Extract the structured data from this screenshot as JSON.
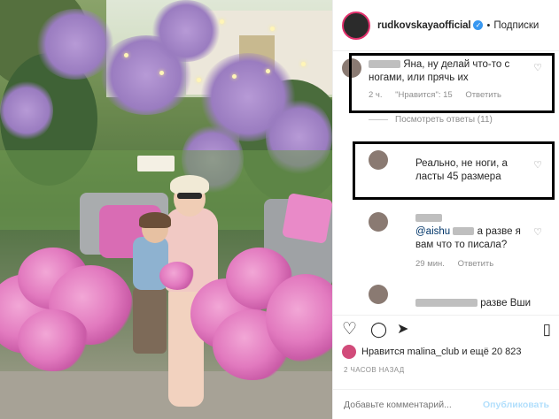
{
  "post": {
    "username": "rudkovskayaofficial",
    "separator": "•",
    "follow_label": "Подписки"
  },
  "comments": [
    {
      "text": "Яна, ну делай что-то с ногами, или прячь их",
      "meta_time": "2 ч.",
      "meta_likes": "\"Нравится\": 15",
      "meta_reply": "Ответить"
    },
    {
      "text": "Реально, не ноги, а ласты 45 размера"
    },
    {
      "mention": "@aishu",
      "text": "а разве я вам что то писала?",
      "meta_time": "29 мин.",
      "meta_reply": "Ответить"
    },
    {
      "text": "разве Вши"
    }
  ],
  "view_replies": "Посмотреть ответы (11)",
  "likes": {
    "text": "Нравится malina_club и ещё 20 823"
  },
  "timestamp": "2 ЧАСОВ НАЗАД",
  "add_comment": {
    "placeholder": "Добавьте комментарий...",
    "publish_label": "Опубликовать"
  },
  "colors": {
    "verified": "#3897f0",
    "highlight_box": "#000000",
    "publish": "#b2dffc"
  }
}
